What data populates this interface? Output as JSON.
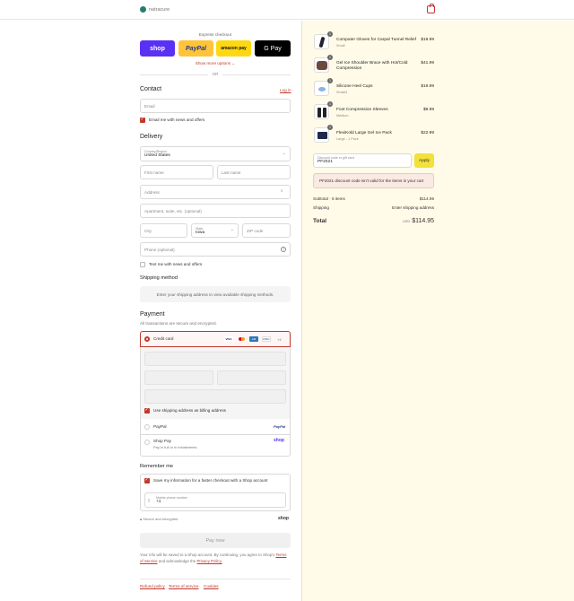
{
  "brand": {
    "name": "natracure"
  },
  "express": {
    "label": "Express checkout",
    "buttons": [
      "shop",
      "PayPal",
      "amazon pay",
      "G Pay"
    ],
    "more": "Show more options",
    "or": "OR"
  },
  "contact": {
    "title": "Contact",
    "login": "Log in",
    "email_placeholder": "Email",
    "news": "Email me with news and offers"
  },
  "delivery": {
    "title": "Delivery",
    "country_label": "Country/Region",
    "country_value": "United States",
    "first_name": "First name",
    "last_name": "Last name",
    "address": "Address",
    "apartment": "Apartment, suite, etc. (optional)",
    "city": "City",
    "state_label": "State",
    "state_value": "Iowa",
    "zip": "ZIP code",
    "phone": "Phone (optional)",
    "text_news": "Text me with news and offers"
  },
  "shipping": {
    "title": "Shipping method",
    "info": "Enter your shipping address to view available shipping methods."
  },
  "payment": {
    "title": "Payment",
    "subtitle": "All transactions are secure and encrypted.",
    "credit_card": "Credit card",
    "card_more": "+4",
    "billing_same": "Use shipping address as billing address",
    "paypal": "PayPal",
    "paypal_logo": "PayPal",
    "shop_pay": "Shop Pay",
    "shop_pay_sub": "Pay in full or in installments",
    "shop_logo": "shop"
  },
  "remember": {
    "title": "Remember me",
    "save": "Save my information for a faster checkout with a Shop account",
    "mobile_label": "Mobile phone number",
    "mobile_value": "+1",
    "secure": "Secure and encrypted",
    "shop_logo": "shop"
  },
  "pay_now": "Pay now",
  "legal": {
    "line1": "Your info will be saved to a Shop account. By continuing, you agree to Shop's",
    "terms": "Terms of Service",
    "and": "and acknowledge the",
    "privacy": "Privacy Policy."
  },
  "footer": {
    "refund": "Refund policy",
    "terms": "Terms of service",
    "cookies": "Cookies"
  },
  "cart": {
    "items": [
      {
        "name": "Computer Gloves for Carpal Tunnel Relief",
        "variant": "Small",
        "price": "$19.99",
        "qty": "1"
      },
      {
        "name": "Gel Ice Shoulder Brace with Hot/Cold Compression",
        "variant": "",
        "price": "$41.99",
        "qty": "1"
      },
      {
        "name": "Silicone Heel Cups",
        "variant": "Small/1",
        "price": "$19.99",
        "qty": "1"
      },
      {
        "name": "Foot Compression Sleeves",
        "variant": "Medium",
        "price": "$9.99",
        "qty": "1"
      },
      {
        "name": "FlexiKold Large Gel Ice Pack",
        "variant": "Large - 1 Pack",
        "price": "$22.99",
        "qty": "1"
      }
    ],
    "discount_label": "Discount code or gift card",
    "discount_value": "PF2021",
    "apply": "Apply",
    "error": "PF2021 discount code isn't valid for the items in your cart",
    "subtotal_label": "Subtotal · 5 items",
    "subtotal": "$114.95",
    "shipping_label": "Shipping",
    "shipping_value": "Enter shipping address",
    "total_label": "Total",
    "currency": "USD",
    "total": "$114.95"
  },
  "colors": {
    "accent": "#c0392b",
    "shop": "#5a31f4",
    "paypal": "#ffc439",
    "amazon": "#ffd814",
    "summary_bg": "#fffbe8"
  }
}
